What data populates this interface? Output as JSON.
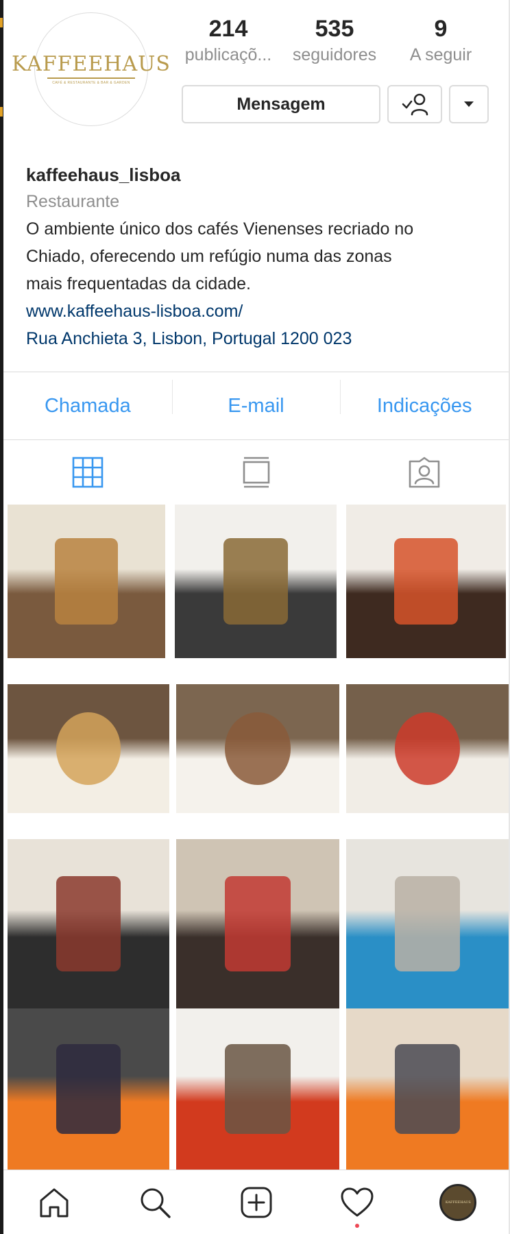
{
  "profile": {
    "logo_text": "KAFFEEHAUS",
    "logo_subtext": "CAFÉ & RESTAURANTE & BAR & GARDEN",
    "stats": [
      {
        "value": "214",
        "label": "publicaçõ..."
      },
      {
        "value": "535",
        "label": "seguidores"
      },
      {
        "value": "9",
        "label": "A seguir"
      }
    ],
    "message_button": "Mensagem",
    "follow_icon": "person-check-icon",
    "more_icon": "caret-down-icon"
  },
  "bio": {
    "username": "kaffeehaus_lisboa",
    "category": "Restaurante",
    "description_lines": [
      "O ambiente único dos cafés Vienenses recriado no",
      "Chiado, oferecendo um refúgio numa das zonas",
      "mais frequentadas da cidade."
    ],
    "website": "www.kaffeehaus-lisboa.com/",
    "address": "Rua Anchieta 3, Lisbon, Portugal 1200 023"
  },
  "contact": {
    "call": "Chamada",
    "email": "E-mail",
    "directions": "Indicações"
  },
  "tabs": [
    {
      "icon": "grid-icon",
      "active": true
    },
    {
      "icon": "feed-icon",
      "active": false
    },
    {
      "icon": "tagged-icon",
      "active": false
    }
  ],
  "posts": [
    {
      "subject": "cider bottles on wooden table",
      "colors": [
        "#e9e2d3",
        "#7a5a3e",
        "#b8823f"
      ]
    },
    {
      "subject": "bar counter with beer tap",
      "colors": [
        "#f2f0ec",
        "#3a3a3a",
        "#8a6a36"
      ]
    },
    {
      "subject": "craft beer bottles",
      "colors": [
        "#f0ece6",
        "#3e2a20",
        "#d6532a"
      ]
    },
    {
      "subject": "pasta dish on wooden table",
      "colors": [
        "#6d5540",
        "#f3eee4",
        "#d3a35a"
      ]
    },
    {
      "subject": "salad plate with fork and napkin",
      "colors": [
        "#7c6650",
        "#f5f2ec",
        "#8a5a3a"
      ]
    },
    {
      "subject": "toast sandwich and greens",
      "colors": [
        "#75604b",
        "#f1ede6",
        "#cc3b2a"
      ]
    },
    {
      "subject": "dining room with tables",
      "colors": [
        "#e8e2d8",
        "#2d2d2d",
        "#8b3a2e"
      ]
    },
    {
      "subject": "cafe corner with red chairs",
      "colors": [
        "#cfc4b4",
        "#3a2f2a",
        "#c23a33"
      ]
    },
    {
      "subject": "wall with graphic posters",
      "colors": [
        "#e7e4de",
        "#2a8fc6",
        "#b8b0a4"
      ]
    },
    {
      "subject": "aperol spritz glass",
      "colors": [
        "#4a4a4a",
        "#ef7a22",
        "#2e2a3e"
      ]
    },
    {
      "subject": "aperol bottle and glass",
      "colors": [
        "#f2f0ec",
        "#d23a1e",
        "#6a5644"
      ]
    },
    {
      "subject": "spritz with poster background",
      "colors": [
        "#e6d9c8",
        "#ef7a22",
        "#4a4a54"
      ]
    }
  ],
  "bottom_nav": [
    {
      "icon": "home-icon"
    },
    {
      "icon": "search-icon"
    },
    {
      "icon": "add-post-icon"
    },
    {
      "icon": "heart-icon",
      "has_notification": true
    },
    {
      "icon": "profile-avatar-icon"
    }
  ],
  "colors": {
    "link_blue": "#3897f0",
    "website_blue": "#00376b",
    "secondary_text": "#8e8e8e",
    "border": "#dbdbdb",
    "logo_gold": "#b89a4c",
    "notification_red": "#ed4956"
  }
}
